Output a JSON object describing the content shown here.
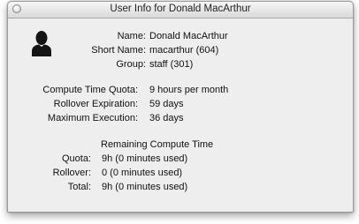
{
  "window": {
    "title": "User Info for Donald MacArthur"
  },
  "user": {
    "name_label": "Name:",
    "name_value": "Donald MacArthur",
    "short_name_label": "Short Name:",
    "short_name_value": "macarthur (604)",
    "group_label": "Group:",
    "group_value": "staff (301)"
  },
  "compute": {
    "quota_label": "Compute Time Quota:",
    "quota_value": "9 hours per month",
    "rollover_expiration_label": "Rollover Expiration:",
    "rollover_expiration_value": "59 days",
    "max_execution_label": "Maximum Execution:",
    "max_execution_value": "36 days"
  },
  "remaining": {
    "heading": "Remaining Compute Time",
    "quota_label": "Quota:",
    "quota_value": "9h (0 minutes used)",
    "rollover_label": "Rollover:",
    "rollover_value": "0 (0 minutes used)",
    "total_label": "Total:",
    "total_value": "9h (0 minutes used)"
  },
  "icons": {
    "close": "close-icon",
    "avatar": "user-silhouette-icon"
  }
}
